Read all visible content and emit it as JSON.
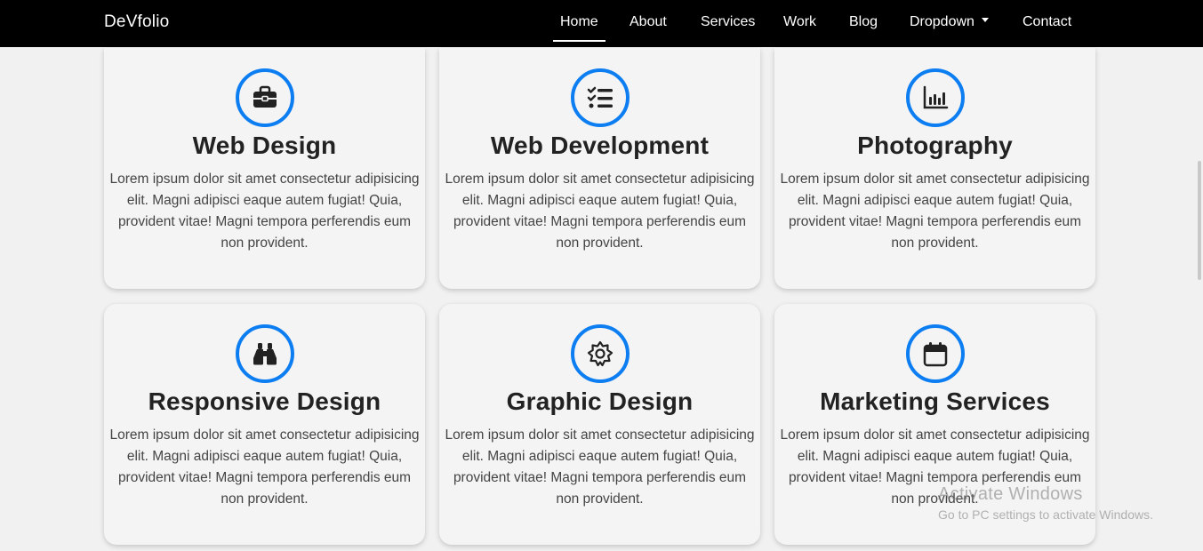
{
  "brand": "DeVfolio",
  "nav": {
    "items": [
      {
        "label": "Home",
        "active": true
      },
      {
        "label": "About",
        "active": false
      },
      {
        "label": "Services",
        "active": false
      },
      {
        "label": "Work",
        "active": false
      },
      {
        "label": "Blog",
        "active": false
      },
      {
        "label": "Dropdown",
        "active": false
      },
      {
        "label": "Contact",
        "active": false
      }
    ]
  },
  "colors": {
    "accent": "#0d7ef2",
    "navbar": "#000000",
    "card": "#f4f4f4",
    "background": "#f1f1f1"
  },
  "cards": [
    {
      "title": "Web Design",
      "icon": "briefcase-icon",
      "text": "Lorem ipsum dolor sit amet consectetur adipisicing elit. Magni adipisci eaque autem fugiat! Quia, provident vitae! Magni tempora perferendis eum non provident."
    },
    {
      "title": "Web Development",
      "icon": "list-check-icon",
      "text": "Lorem ipsum dolor sit amet consectetur adipisicing elit. Magni adipisci eaque autem fugiat! Quia, provident vitae! Magni tempora perferendis eum non provident."
    },
    {
      "title": "Photography",
      "icon": "bar-chart-icon",
      "text": "Lorem ipsum dolor sit amet consectetur adipisicing elit. Magni adipisci eaque autem fugiat! Quia, provident vitae! Magni tempora perferendis eum non provident."
    },
    {
      "title": "Responsive Design",
      "icon": "binoculars-icon",
      "text": "Lorem ipsum dolor sit amet consectetur adipisicing elit. Magni adipisci eaque autem fugiat! Quia, provident vitae! Magni tempora perferendis eum non provident."
    },
    {
      "title": "Graphic Design",
      "icon": "gear-icon",
      "text": "Lorem ipsum dolor sit amet consectetur adipisicing elit. Magni adipisci eaque autem fugiat! Quia, provident vitae! Magni tempora perferendis eum non provident."
    },
    {
      "title": "Marketing Services",
      "icon": "calendar-icon",
      "text": "Lorem ipsum dolor sit amet consectetur adipisicing elit. Magni adipisci eaque autem fugiat! Quia, provident vitae! Magni tempora perferendis eum non provident."
    }
  ],
  "watermark": {
    "title": "Activate Windows",
    "subtitle": "Go to PC settings to activate Windows."
  }
}
